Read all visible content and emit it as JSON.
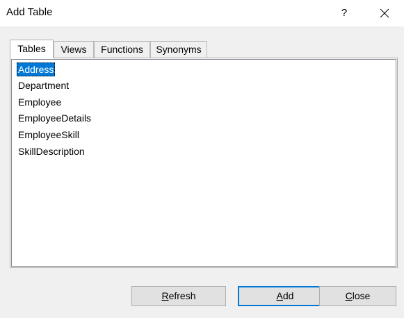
{
  "window": {
    "title": "Add Table",
    "help_label": "?"
  },
  "tabs": [
    {
      "label": "Tables",
      "active": true
    },
    {
      "label": "Views",
      "active": false
    },
    {
      "label": "Functions",
      "active": false
    },
    {
      "label": "Synonyms",
      "active": false
    }
  ],
  "tables_list": {
    "items": [
      "Address",
      "Department",
      "Employee",
      "EmployeeDetails",
      "EmployeeSkill",
      "SkillDescription"
    ],
    "selected": "Address"
  },
  "buttons": {
    "refresh": {
      "mnemonic": "R",
      "rest": "efresh"
    },
    "add": {
      "mnemonic": "A",
      "rest": "dd"
    },
    "close": {
      "mnemonic": "C",
      "rest": "lose"
    }
  },
  "colors": {
    "selection": "#0078d7",
    "dialog_background": "#f0f0f0"
  }
}
